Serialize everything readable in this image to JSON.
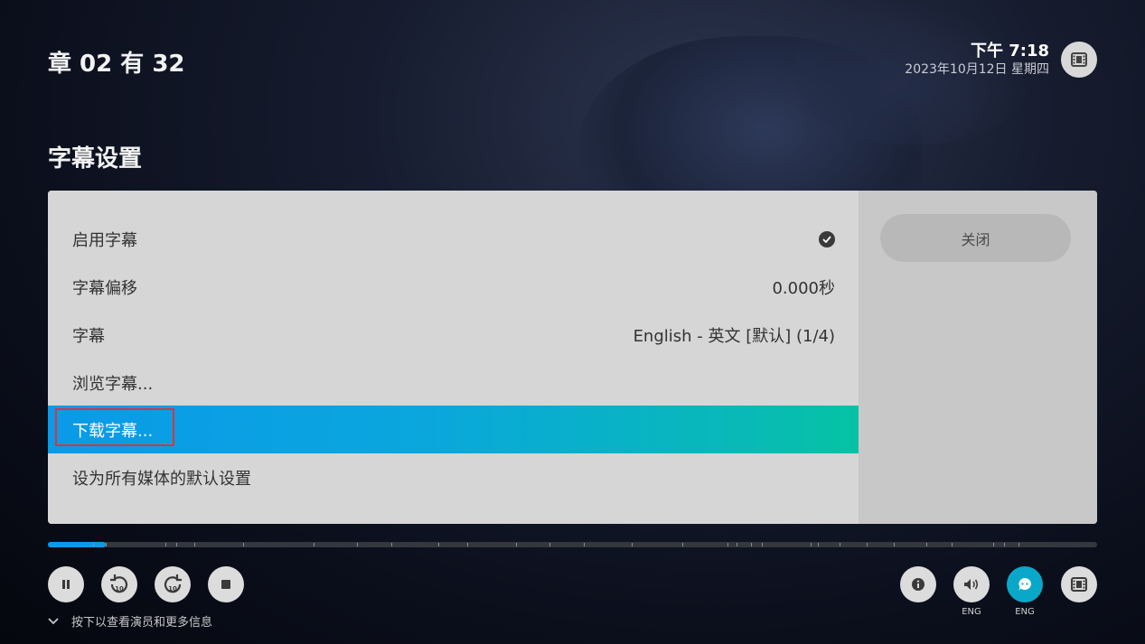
{
  "header": {
    "chapter_title": "章 02 有 32",
    "time": "下午 7:18",
    "date": "2023年10月12日 星期四"
  },
  "section_title": "字幕设置",
  "menu": {
    "items": [
      {
        "label": "启用字幕",
        "value": "",
        "checked": true
      },
      {
        "label": "字幕偏移",
        "value": "0.000秒"
      },
      {
        "label": "字幕",
        "value": "English - 英文 [默认] (1/4)"
      },
      {
        "label": "浏览字幕...",
        "value": ""
      },
      {
        "label": "下载字幕...",
        "value": "",
        "focused": true
      },
      {
        "label": "设为所有媒体的默认设置",
        "value": ""
      }
    ]
  },
  "side": {
    "close_label": "关闭"
  },
  "playback": {
    "progress_fraction": 0.055,
    "hint": "按下以查看演员和更多信息",
    "audio_label": "ENG",
    "subtitle_label": "ENG",
    "rewind_seconds": "10",
    "forward_seconds": "10"
  },
  "colors": {
    "accent": "#0a9ae8",
    "accent_end": "#06c3a4",
    "focus_outline": "#e0323a"
  },
  "icons": {
    "top_right": "film-icon",
    "pause": "pause-icon",
    "rewind": "replay-10-icon",
    "forward": "forward-10-icon",
    "stop": "stop-icon",
    "info": "info-icon",
    "audio": "volume-icon",
    "subtitles": "chat-subtitle-icon",
    "media": "film-icon"
  }
}
